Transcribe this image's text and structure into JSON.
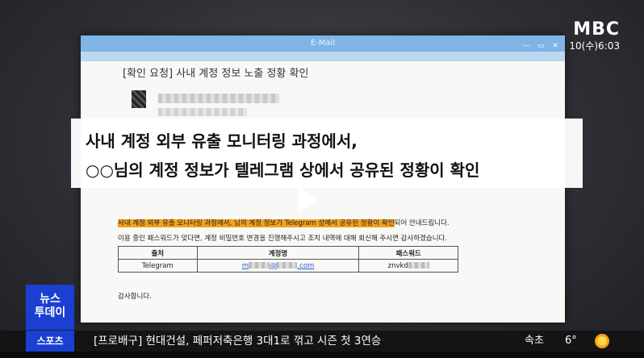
{
  "broadcast": {
    "logo": "MBC",
    "datetime": "10(수)6:03"
  },
  "email_window": {
    "title": "E-Mail",
    "controls": [
      "—",
      "▭",
      "✕"
    ],
    "subject": "[확인 요청] 사내 계정 정보 노출 정황 확인",
    "body_line1_highlight": "사내 계정 외부 유출 모니터링 과정에서,      님의 계정 정보가 Telegram 상에서 공유된 정황이 확인",
    "body_line1_rest": "되어 안내드립니다.",
    "body_line2": "이용 중인 패스워드가 맞다면, 계정 비밀번호 변경을 진행해주시고 조치 내역에 대해 회신해 주시면 감사하겠습니다.",
    "table": {
      "headers": [
        "출처",
        "계정명",
        "패스워드"
      ],
      "row": {
        "source": "Telegram",
        "account_prefix": "m",
        "account_mid": "@",
        "account_suffix": ".com",
        "password": "znvkd"
      }
    },
    "closing": "감사합니다."
  },
  "caption": {
    "line1": "사내 계정 외부 유출 모니터링 과정에서,",
    "line2": "○○님의 계정 정보가 텔레그램 상에서 공유된 정황이 확인"
  },
  "badge": {
    "line1": "뉴스",
    "line2": "투데이"
  },
  "ticker": {
    "category": "스포츠",
    "headline": "[프로배구] 현대건설, 페퍼저축은행 3대1로 꺾고 시즌 첫 3연승",
    "city": "속초",
    "temperature": "6°"
  },
  "colors": {
    "highlight": "#f3a21d",
    "badge_blue": "#1a3fd1",
    "titlebar": "#7eb4e6"
  }
}
